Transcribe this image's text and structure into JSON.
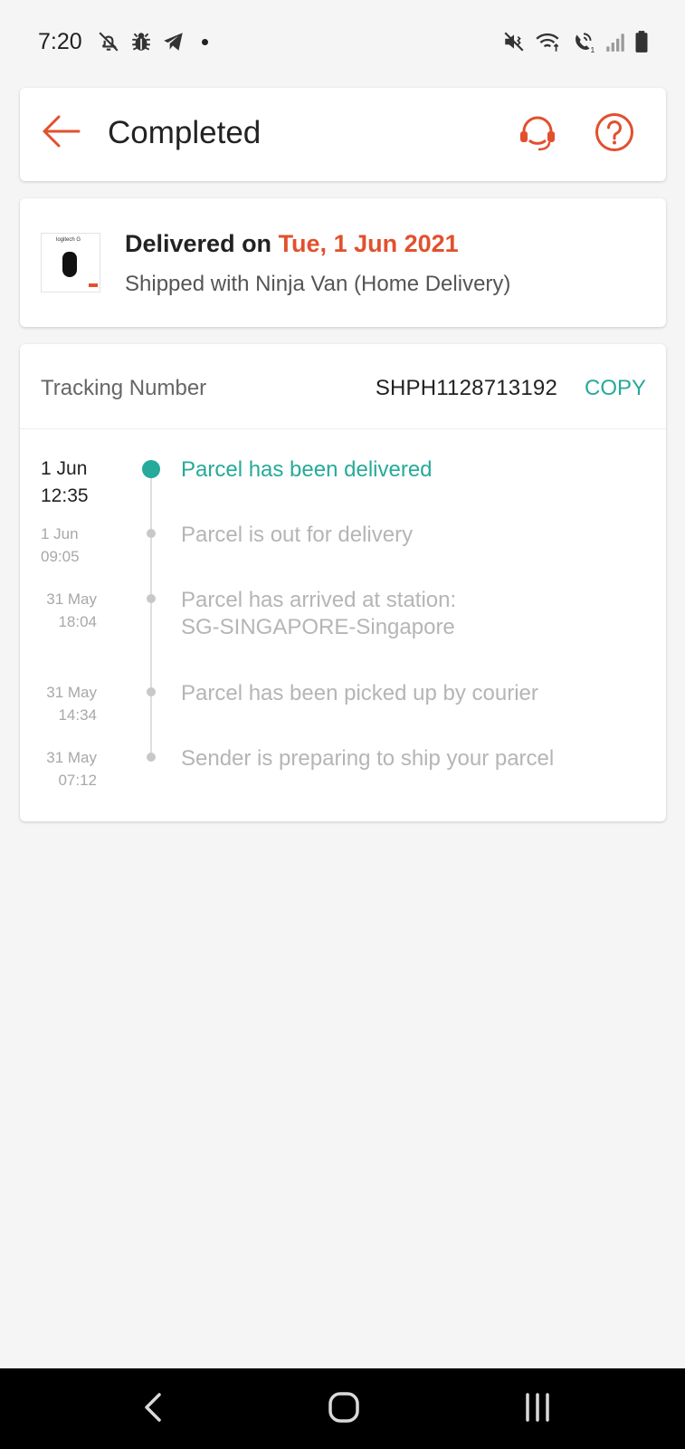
{
  "status_bar": {
    "time": "7:20",
    "left_icons": [
      "notifications-off-icon",
      "bug-icon",
      "telegram-icon",
      "dot"
    ],
    "right_icons": [
      "vibrate-icon",
      "wifi-icon",
      "wifi-call-icon",
      "signal-icon",
      "battery-icon"
    ]
  },
  "header": {
    "title": "Completed",
    "back_icon": "arrow-left-icon",
    "support_icon": "headset-icon",
    "help_icon": "question-circle-icon"
  },
  "delivery": {
    "prefix": "Delivered on ",
    "date": "Tue, 1 Jun 2021",
    "shipping": "Shipped with Ninja Van (Home Delivery)"
  },
  "tracking": {
    "label": "Tracking Number",
    "number": "SHPH1128713192",
    "copy_label": "COPY",
    "events": [
      {
        "date": "1 Jun",
        "time": "12:35",
        "text": "Parcel has been delivered",
        "text2": ""
      },
      {
        "date": "1 Jun",
        "time": "09:05",
        "text": "Parcel is out for delivery",
        "text2": ""
      },
      {
        "date": "31 May",
        "time": "18:04",
        "text": "Parcel has arrived at station:",
        "text2": "SG-SINGAPORE-Singapore"
      },
      {
        "date": "31 May",
        "time": "14:34",
        "text": "Parcel has been picked up by courier",
        "text2": ""
      },
      {
        "date": "31 May",
        "time": "07:12",
        "text": "Sender is preparing to ship your parcel",
        "text2": ""
      }
    ]
  },
  "colors": {
    "accent_orange": "#e2502d",
    "accent_teal": "#26aa99",
    "background": "#f5f5f5"
  },
  "nav": {
    "back_icon": "nav-back-icon",
    "home_icon": "nav-home-icon",
    "recents_icon": "nav-recents-icon"
  }
}
